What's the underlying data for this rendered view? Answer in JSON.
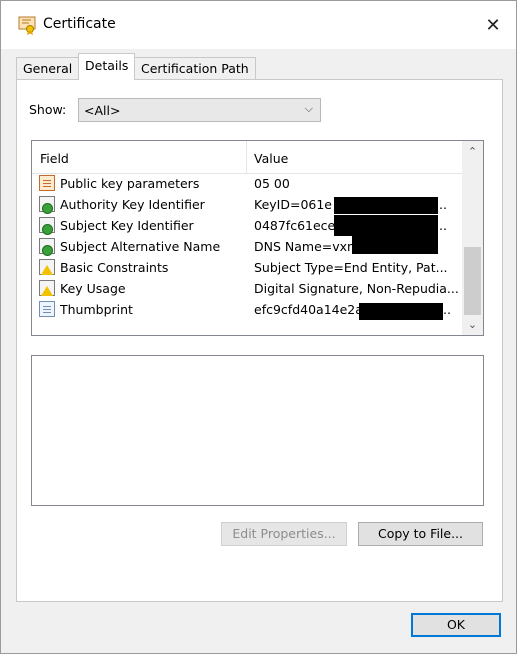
{
  "window": {
    "title": "Certificate"
  },
  "tabs": [
    {
      "label": "General"
    },
    {
      "label": "Details"
    },
    {
      "label": "Certification Path"
    }
  ],
  "show": {
    "label": "Show:",
    "selected": "<All>"
  },
  "list": {
    "headers": {
      "field": "Field",
      "value": "Value"
    },
    "rows": [
      {
        "field": "Public key parameters",
        "value": "05 00",
        "icon": "certificate-field-icon"
      },
      {
        "field": "Authority Key Identifier",
        "value": "KeyID=061e",
        "tail": "..",
        "icon": "extension-icon"
      },
      {
        "field": "Subject Key Identifier",
        "value": "0487fc61ece",
        "tail": "..",
        "icon": "extension-icon"
      },
      {
        "field": "Subject Alternative Name",
        "value": "DNS Name=vxm",
        "tail": "",
        "icon": "extension-icon"
      },
      {
        "field": "Basic Constraints",
        "value": "Subject Type=End Entity, Pat...",
        "icon": "critical-extension-icon"
      },
      {
        "field": "Key Usage",
        "value": "Digital Signature, Non-Repudia...",
        "icon": "critical-extension-icon"
      },
      {
        "field": "Thumbprint",
        "value": "efc9cfd40a14e2a",
        "tail": "..",
        "icon": "thumbprint-icon"
      }
    ]
  },
  "buttons": {
    "edit_properties": "Edit Properties...",
    "copy_to_file": "Copy to File...",
    "ok": "OK"
  }
}
